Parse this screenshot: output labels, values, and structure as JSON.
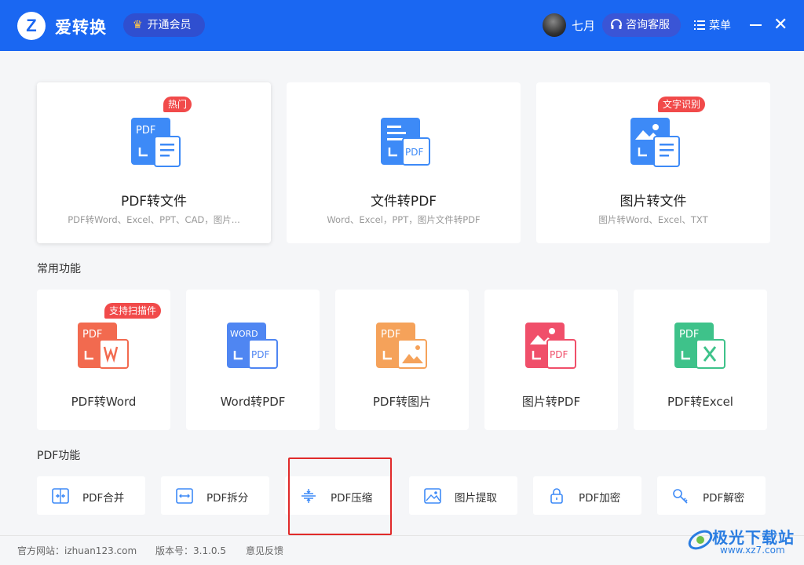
{
  "header": {
    "logo_letter": "Z",
    "app_name": "爱转换",
    "vip_label": "开通会员",
    "username": "七月",
    "support_label": "咨询客服",
    "menu_label": "菜单"
  },
  "main_cards": [
    {
      "title": "PDF转文件",
      "subtitle": "PDF转Word、Excel、PPT、CAD，图片...",
      "tag": "热门",
      "icon_text": "PDF"
    },
    {
      "title": "文件转PDF",
      "subtitle": "Word、Excel，PPT，图片文件转PDF",
      "icon_text": "PDF"
    },
    {
      "title": "图片转文件",
      "subtitle": "图片转Word、Excel、TXT",
      "tag": "文字识别"
    }
  ],
  "common_section": {
    "title": "常用功能",
    "items": [
      {
        "label": "PDF转Word",
        "tag": "支持扫描件",
        "icon_text": "PDF",
        "color": "#f26a4f"
      },
      {
        "label": "Word转PDF",
        "icon_text": "WORD",
        "icon_text2": "PDF",
        "color": "#4f86f2"
      },
      {
        "label": "PDF转图片",
        "icon_text": "PDF",
        "color": "#f5a25a"
      },
      {
        "label": "图片转PDF",
        "icon_text": "PDF",
        "color": "#f04f6a"
      },
      {
        "label": "PDF转Excel",
        "icon_text": "PDF",
        "color": "#3ec28a"
      }
    ]
  },
  "pdf_section": {
    "title": "PDF功能",
    "items": [
      {
        "label": "PDF合并",
        "icon": "merge-icon"
      },
      {
        "label": "PDF拆分",
        "icon": "split-icon"
      },
      {
        "label": "PDF压缩",
        "icon": "compress-icon"
      },
      {
        "label": "图片提取",
        "icon": "image-extract-icon"
      },
      {
        "label": "PDF加密",
        "icon": "lock-icon"
      },
      {
        "label": "PDF解密",
        "icon": "key-icon"
      }
    ]
  },
  "footer": {
    "website": "官方网站：izhuan123.com",
    "version": "版本号：3.1.0.5",
    "feedback": "意见反馈"
  },
  "watermark": {
    "title": "极光下载站",
    "url": "www.xz7.com"
  },
  "colors": {
    "primary": "#1a67f2",
    "tag_red": "#f14a4a",
    "icon_blue": "#3d8af7"
  }
}
